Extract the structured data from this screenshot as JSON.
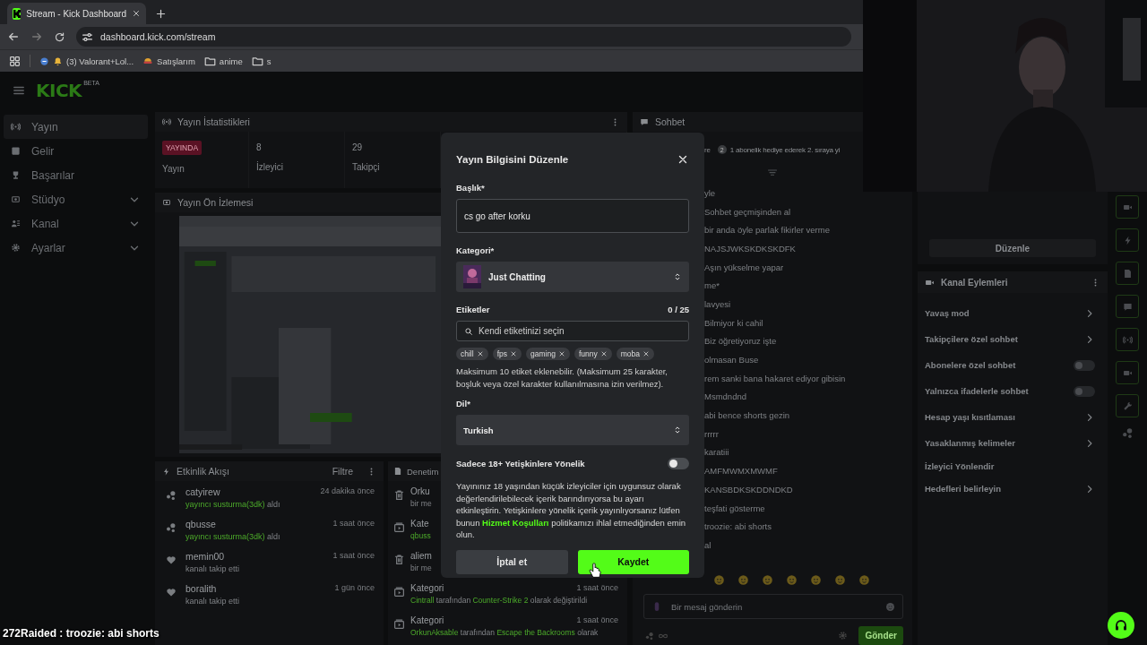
{
  "browser": {
    "tab": {
      "title": "Stream - Kick Dashboard"
    },
    "url": "dashboard.kick.com/stream",
    "bookmarks": [
      {
        "kind": "site",
        "label": "(3) Valorant+Lol..."
      },
      {
        "kind": "shop",
        "label": "Satışlarım"
      },
      {
        "kind": "folder",
        "label": "anime"
      },
      {
        "kind": "folder",
        "label": "s"
      }
    ]
  },
  "header": {
    "logo": "KICK",
    "logo_badge": "BETA"
  },
  "sidebar": {
    "items": [
      {
        "label": "Yayın",
        "selected": true,
        "has_submenu": false
      },
      {
        "label": "Gelir",
        "selected": false,
        "has_submenu": false
      },
      {
        "label": "Başarılar",
        "selected": false,
        "has_submenu": false
      },
      {
        "label": "Stüdyo",
        "selected": false,
        "has_submenu": true
      },
      {
        "label": "Kanal",
        "selected": false,
        "has_submenu": true
      },
      {
        "label": "Ayarlar",
        "selected": false,
        "has_submenu": true
      }
    ]
  },
  "stats_panel": {
    "title": "Yayın İstatistikleri",
    "stats": [
      {
        "kind": "badge",
        "value": "YAYINDA",
        "label": "Yayın"
      },
      {
        "kind": "number",
        "value": "8",
        "label": "İzleyici"
      },
      {
        "kind": "number",
        "value": "29",
        "label": "Takipçi"
      }
    ]
  },
  "preview_panel": {
    "title": "Yayın Ön İzlemesi"
  },
  "activity_panel": {
    "title": "Etkinlik Akışı",
    "filter": "Filtre",
    "items": [
      {
        "kind": "mute",
        "user": "catyirew",
        "time": "24 dakika önce",
        "detail": [
          {
            "text": "yayıncı susturma(3dk)",
            "highlight": true
          },
          {
            "text": "aldı",
            "highlight": false
          }
        ]
      },
      {
        "kind": "mute",
        "user": "qbusse",
        "time": "1 saat önce",
        "detail": [
          {
            "text": "yayıncı susturma(3dk)",
            "highlight": true
          },
          {
            "text": "aldı",
            "highlight": false
          }
        ]
      },
      {
        "kind": "follow",
        "user": "memin00",
        "time": "1 saat önce",
        "detail": [
          {
            "text": "kanalı takip etti",
            "highlight": false
          }
        ]
      },
      {
        "kind": "follow",
        "user": "boralith",
        "time": "1 gün önce",
        "detail": [
          {
            "text": "kanalı takip etti",
            "highlight": false
          }
        ]
      }
    ]
  },
  "moderation_panel": {
    "title": "Denetim",
    "items": [
      {
        "kind": "delete",
        "title": "Orku",
        "detail": [
          {
            "text": "bir me",
            "highlight": false
          }
        ]
      },
      {
        "kind": "category",
        "title": "Kate",
        "detail": [
          {
            "text": "qbuss",
            "highlight": true
          }
        ]
      },
      {
        "kind": "delete",
        "title": "aliem",
        "detail": [
          {
            "text": "bir me",
            "highlight": false
          }
        ]
      },
      {
        "kind": "category",
        "title": "Kategori",
        "time": "1 saat önce",
        "detail": [
          {
            "text": "Cintrall",
            "highlight": true
          },
          {
            "text": "tarafından",
            "highlight": false
          },
          {
            "text": "Counter-Strike 2",
            "highlight": true
          },
          {
            "text": "olarak değiştirildi",
            "highlight": false
          }
        ]
      },
      {
        "kind": "category",
        "title": "Kategori",
        "time": "1 saat önce",
        "detail": [
          {
            "text": "OrkunAksable",
            "highlight": true
          },
          {
            "text": "tarafından",
            "highlight": false
          },
          {
            "text": "Escape the Backrooms",
            "highlight": true
          },
          {
            "text": "olarak",
            "highlight": false
          }
        ]
      }
    ]
  },
  "chat": {
    "title": "Sohbet",
    "pinned_prefix": "re",
    "pinned_badge": "2",
    "pinned": "1 abonelik hediye ederek 2. sıraya yi",
    "messages": [
      "yle",
      "Sohbet geçmişinden al",
      "bir anda öyle parlak fikirler verme",
      "NAJSJWKSKDKSKDFK",
      "Aşın yükselme yapar",
      "me*",
      "lavyesi",
      "Bilmiyor ki cahil",
      "Biz öğretiyoruz işte",
      "olmasan Buse",
      "rem sanki bana hakaret ediyor gibisin",
      "Msmdndnd",
      "abi bence shorts gezin",
      "rrrrr",
      "karatiii",
      "AMFMWMXMWMF",
      "KANSBDKSKDDNDKD",
      "teşfati gösterme",
      "troozie: abi shorts",
      "al"
    ],
    "input": {
      "placeholder": "Bir mesaj gönderin"
    },
    "send": "Gönder"
  },
  "channel_panel": {
    "edit_button": "Düzenle",
    "title": "Kanal Eylemleri",
    "actions": [
      {
        "kind": "submenu",
        "label": "Yavaş mod"
      },
      {
        "kind": "submenu",
        "label": "Takipçilere özel sohbet"
      },
      {
        "kind": "toggle",
        "label": "Abonelere özel sohbet",
        "on": false
      },
      {
        "kind": "toggle",
        "label": "Yalnızca ifadelerle sohbet",
        "on": false
      },
      {
        "kind": "submenu",
        "label": "Hesap yaşı kısıtlaması"
      },
      {
        "kind": "submenu",
        "label": "Yasaklanmış kelimeler"
      },
      {
        "kind": "plain",
        "label": "İzleyici Yönlendir"
      },
      {
        "kind": "submenu",
        "label": "Hedefleri belirleyin"
      }
    ]
  },
  "modal": {
    "title": "Yayın Bilgisini Düzenle",
    "title_field": {
      "label": "Başlık*",
      "value": "cs go after korku"
    },
    "category": {
      "label": "Kategori*",
      "value": "Just Chatting"
    },
    "tags": {
      "label": "Etiketler",
      "count": "0 / 25",
      "placeholder": "Kendi etiketinizi seçin",
      "chips": [
        "chill",
        "fps",
        "gaming",
        "funny",
        "moba"
      ],
      "help": "Maksimum 10 etiket eklenebilir. (Maksimum 25 karakter, boşluk veya özel karakter kullanılmasına izin verilmez)."
    },
    "language": {
      "label": "Dil*",
      "value": "Turkish"
    },
    "adult": {
      "label": "Sadece 18+ Yetişkinlere Yönelik",
      "on": false,
      "notice_before": "Yayınınız 18 yaşından küçük izleyiciler için uygunsuz olarak değerlendirilebilecek içerik barındırıyorsa bu ayarı etkinleştirin. Yetişkinlere yönelik içerik yayınlıyorsanız lütfen bunun",
      "link": "Hizmet Koşulları",
      "notice_after": "politikamızı ihlal etmediğinden emin olun."
    },
    "buttons": {
      "cancel": "İptal et",
      "save": "Kaydet"
    }
  },
  "raid_overlay": {
    "text": "272Raided : troozie: abi shorts"
  }
}
